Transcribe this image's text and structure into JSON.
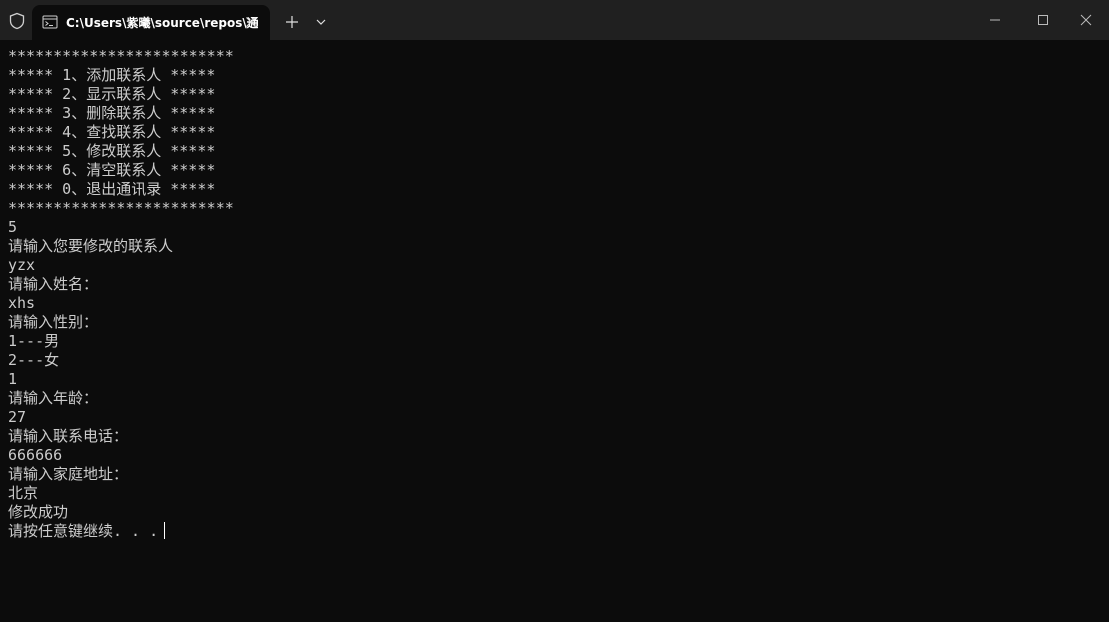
{
  "tab": {
    "title": "C:\\Users\\紫曦\\source\\repos\\通",
    "icon": "terminal-icon"
  },
  "console": {
    "lines": [
      "*************************",
      "***** 1、添加联系人 *****",
      "***** 2、显示联系人 *****",
      "***** 3、删除联系人 *****",
      "***** 4、查找联系人 *****",
      "***** 5、修改联系人 *****",
      "***** 6、清空联系人 *****",
      "***** 0、退出通讯录 *****",
      "*************************",
      "5",
      "请输入您要修改的联系人",
      "yzx",
      "请输入姓名：",
      "xhs",
      "请输入性别：",
      "1---男",
      "2---女",
      "1",
      "请输入年龄：",
      "27",
      "请输入联系电话：",
      "666666",
      "请输入家庭地址：",
      "北京",
      "修改成功",
      "请按任意键继续. . ."
    ]
  },
  "colors": {
    "background": "#0c0c0c",
    "titlebar": "#202020",
    "text": "#cccccc"
  }
}
